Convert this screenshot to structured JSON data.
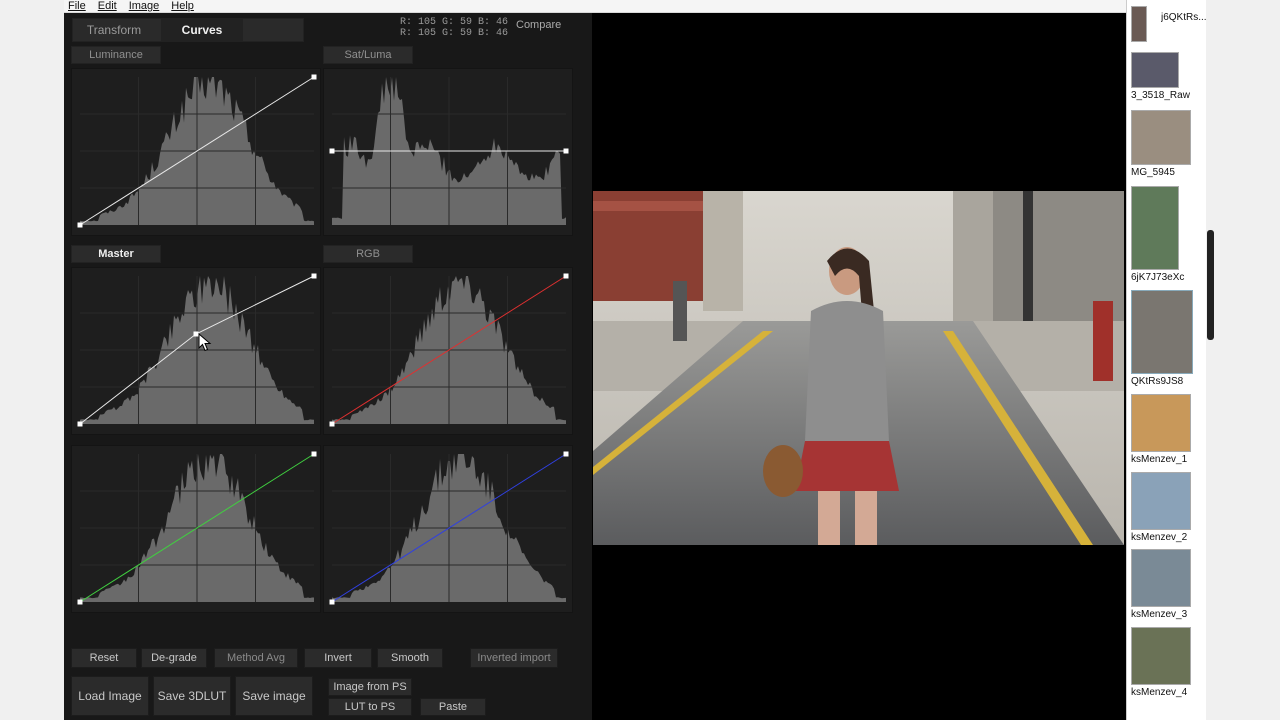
{
  "menu": {
    "file": "File",
    "edit": "Edit",
    "image": "Image",
    "help": "Help"
  },
  "tabs": {
    "transform": "Transform",
    "curves": "Curves"
  },
  "readout": {
    "line1": "R: 105  G:  59  B:  46",
    "line2": "R: 105  G:  59  B:  46"
  },
  "compare": "Compare",
  "panels": {
    "luminance": "Luminance",
    "sat_luma": "Sat/Luma",
    "master": "Master",
    "rgb": "RGB"
  },
  "buttons": {
    "reset": "Reset",
    "degrade": "De-grade",
    "method": "Method Avg",
    "invert": "Invert",
    "smooth": "Smooth",
    "inverted_import": "Inverted import",
    "load_image": "Load Image",
    "save_3dlut": "Save 3DLUT",
    "save_image": "Save image",
    "image_from_ps": "Image from PS",
    "lut_to_ps": "LUT to PS",
    "paste": "Paste"
  },
  "filmstrip": {
    "items": [
      {
        "label": "j6QKtRs..."
      },
      {
        "label": "3_3518_Raw"
      },
      {
        "label": "MG_5945"
      },
      {
        "label": "6jK7J73eXc"
      },
      {
        "label": "QKtRs9JS8"
      },
      {
        "label": "ksMenzev_1"
      },
      {
        "label": "ksMenzev_2"
      },
      {
        "label": "ksMenzev_3"
      },
      {
        "label": "ksMenzev_4"
      }
    ]
  },
  "colors": {
    "red_curve": "#e03030",
    "green_curve": "#40d040",
    "blue_curve": "#3040e0",
    "white_curve": "#e8e8e8"
  }
}
